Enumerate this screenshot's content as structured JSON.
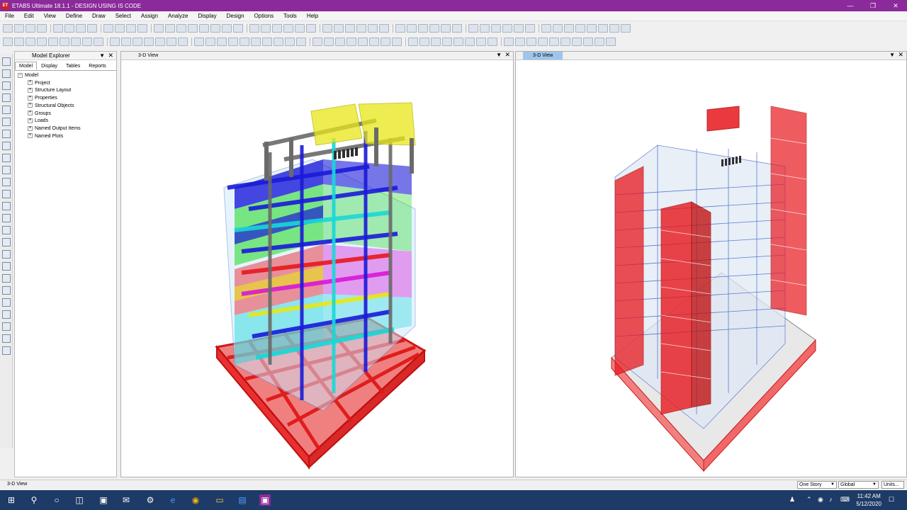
{
  "window": {
    "title": "ETABS Ultimate 18.1.1 - DESIGN USING IS CODE",
    "app_icon": "ET"
  },
  "menu": [
    "File",
    "Edit",
    "View",
    "Define",
    "Draw",
    "Select",
    "Assign",
    "Analyze",
    "Display",
    "Design",
    "Options",
    "Tools",
    "Help"
  ],
  "explorer": {
    "title": "Model Explorer",
    "tabs": [
      "Model",
      "Display",
      "Tables",
      "Reports"
    ],
    "active_tab": "Model",
    "root": "Model",
    "items": [
      "Project",
      "Structure Layout",
      "Properties",
      "Structural Objects",
      "Groups",
      "Loads",
      "Named Output Items",
      "Named Plots"
    ]
  },
  "views": {
    "left": {
      "tab": "3-D View"
    },
    "right": {
      "tab": "3-D View"
    }
  },
  "status": {
    "text": "3-D View",
    "story": "One Story",
    "coord": "Global",
    "units": "Units..."
  },
  "taskbar": {
    "time": "11:42 AM",
    "date": "5/12/2020"
  },
  "colors": {
    "title_bar": "#8b2a9a",
    "active_tab": "#9fc5ec",
    "taskbar": "#1e3a66",
    "red_member": "#e8181e",
    "blue_member": "#1a1ad8",
    "green_member": "#1ed81e",
    "cyan_member": "#18d8d8",
    "magenta_member": "#d818d8",
    "yellow_member": "#e8e818",
    "gray_member": "#6a6a6a"
  }
}
